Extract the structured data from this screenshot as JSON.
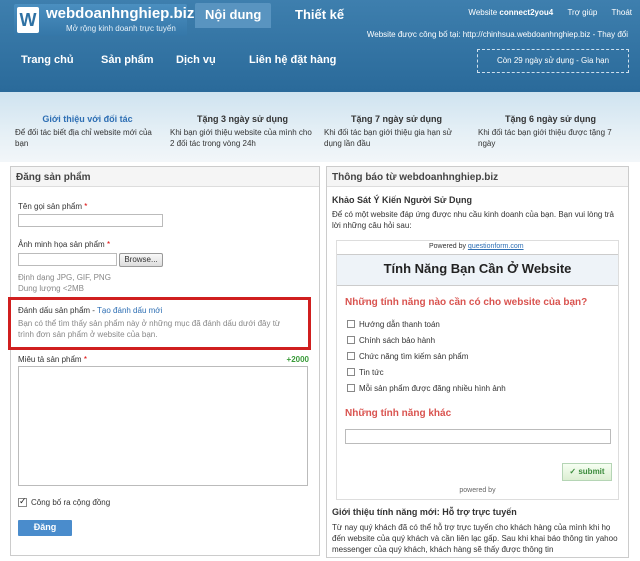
{
  "header": {
    "logo_letter": "W",
    "logo_name": "webdoanhnghiep.biz",
    "logo_tagline": "Mở rộng kinh doanh trực tuyến",
    "tabs": [
      {
        "label": "Nội dung"
      },
      {
        "label": "Thiết kế"
      }
    ],
    "website_label": "Website",
    "website_name": "connect2you4",
    "help": "Trợ giúp",
    "logout": "Thoát",
    "published_info": "Website được công bố tại: http://chinhsua.webdoanhnghiep.biz - Thay đổi",
    "nav": [
      "Trang chủ",
      "Sản phẩm",
      "Dịch vụ",
      "Liên hệ đặt hàng"
    ],
    "remaining": "Còn 29 ngày sử dụng - Gia hạn"
  },
  "promos": [
    {
      "title": "Giới thiệu với đối tác",
      "desc": "Để đối tác biết địa chỉ website mới của bạn"
    },
    {
      "title": "Tặng 3 ngày sử dụng",
      "desc": "Khi bạn giới thiệu website của mình cho 2 đối tác trong vòng 24h"
    },
    {
      "title": "Tặng 7 ngày sử dụng",
      "desc": "Khi đối tác bạn giới thiệu gia hạn sử dụng lần đầu"
    },
    {
      "title": "Tặng 6 ngày sử dụng",
      "desc": "Khi đối tác bạn giới thiệu được tặng 7 ngày"
    }
  ],
  "post_product": {
    "heading": "Đăng sản phẩm",
    "name_label": "Tên gọi sản phẩm",
    "image_label": "Ảnh minh họa sản phẩm",
    "browse": "Browse...",
    "format_hint": "Định dạng JPG, GIF, PNG",
    "size_hint": "Dung lượng <2MB",
    "tag_label": "Đánh dấu sản phẩm",
    "tag_link": "Tạo đánh dấu mới",
    "tag_hint_1": "Bạn có thể tìm thấy sản phẩm này ở những mục đã đánh dấu dưới đây từ",
    "tag_hint_2": "trình đơn sản phẩm ở website của bạn.",
    "desc_label": "Miêu tả sản phẩm",
    "counter": "+2000",
    "publish_label": "Công bố ra cộng đồng",
    "submit": "Đăng",
    "required_mark": "*"
  },
  "notice": {
    "heading": "Thông báo từ webdoanhnghiep.biz",
    "survey_title": "Khảo Sát Ý Kiến Người Sử Dụng",
    "survey_intro": "Để có một website đáp ứng được nhu cầu kinh doanh của bạn. Bạn vui lòng trả lời những câu hỏi sau:",
    "powered_prefix": "Powered by",
    "powered_link": "questionform.com",
    "form_title": "Tính Năng Bạn Cần Ở Website",
    "question_1": "Những tính năng nào cần có cho website của bạn?",
    "options": [
      "Hướng dẫn thanh toán",
      "Chính sách bảo hành",
      "Chức năng tìm kiếm sản phẩm",
      "Tin tức",
      "Mỗi sản phẩm được đăng nhiều hình ảnh"
    ],
    "question_2": "Những tính năng khác",
    "submit": "submit",
    "powered_bottom": "powered by",
    "news_title": "Giới thiệu tính năng mới: Hỗ trợ trực tuyến",
    "news_body": "Từ nay quý khách đã có thể hỗ trợ trực tuyến cho khách hàng của mình khi họ đến website của quý khách và cần liên lạc gấp. Sau khi khai báo thông tin yahoo messenger của quý khách, khách hàng sẽ thấy được thông tin"
  }
}
